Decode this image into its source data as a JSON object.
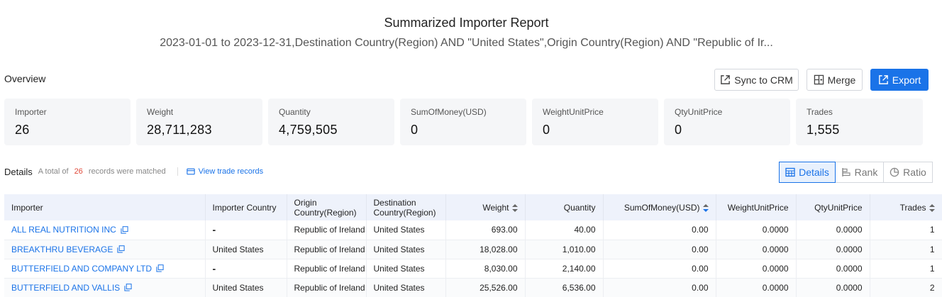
{
  "report": {
    "title": "Summarized Importer Report",
    "subtitle": "2023-01-01 to 2023-12-31,Destination Country(Region) AND \"United States\",Origin Country(Region) AND \"Republic of Ir..."
  },
  "overview": {
    "label": "Overview",
    "buttons": {
      "sync": "Sync to CRM",
      "merge": "Merge",
      "export": "Export"
    },
    "stats": [
      {
        "label": "Importer",
        "value": "26"
      },
      {
        "label": "Weight",
        "value": "28,711,283"
      },
      {
        "label": "Quantity",
        "value": "4,759,505"
      },
      {
        "label": "SumOfMoney(USD)",
        "value": "0"
      },
      {
        "label": "WeightUnitPrice",
        "value": "0"
      },
      {
        "label": "QtyUnitPrice",
        "value": "0"
      },
      {
        "label": "Trades",
        "value": "1,555"
      }
    ]
  },
  "details": {
    "label": "Details",
    "total_prefix": "A total of",
    "count": "26",
    "total_suffix": "records were matched",
    "view_link": "View trade records",
    "views": {
      "details": "Details",
      "rank": "Rank",
      "ratio": "Ratio"
    }
  },
  "table": {
    "headers": {
      "importer": "Importer",
      "importer_country": "Importer Country",
      "origin": "Origin Country(Region)",
      "destination": "Destination Country(Region)",
      "weight": "Weight",
      "quantity": "Quantity",
      "sum": "SumOfMoney(USD)",
      "wup": "WeightUnitPrice",
      "qup": "QtyUnitPrice",
      "trades": "Trades"
    },
    "rows": [
      {
        "importer": "ALL REAL NUTRITION INC",
        "importer_country": "-",
        "origin": "Republic of Ireland",
        "destination": "United States",
        "weight": "693.00",
        "quantity": "40.00",
        "sum": "0.00",
        "wup": "0.0000",
        "qup": "0.0000",
        "trades": "1"
      },
      {
        "importer": "BREAKTHRU BEVERAGE",
        "importer_country": "United States",
        "origin": "Republic of Ireland",
        "destination": "United States",
        "weight": "18,028.00",
        "quantity": "1,010.00",
        "sum": "0.00",
        "wup": "0.0000",
        "qup": "0.0000",
        "trades": "1"
      },
      {
        "importer": "BUTTERFIELD AND COMPANY LTD",
        "importer_country": "-",
        "origin": "Republic of Ireland",
        "destination": "United States",
        "weight": "8,030.00",
        "quantity": "2,140.00",
        "sum": "0.00",
        "wup": "0.0000",
        "qup": "0.0000",
        "trades": "1"
      },
      {
        "importer": "BUTTERFIELD AND VALLIS",
        "importer_country": "United States",
        "origin": "Republic of Ireland",
        "destination": "United States",
        "weight": "25,526.00",
        "quantity": "6,536.00",
        "sum": "0.00",
        "wup": "0.0000",
        "qup": "0.0000",
        "trades": "2"
      }
    ]
  },
  "icons": {
    "sync": "external-link-icon",
    "merge": "merge-icon",
    "export": "export-icon",
    "view": "card-icon",
    "copy": "copy-icon",
    "sort": "sort-icon",
    "details_view": "table-icon",
    "rank_view": "bar-icon",
    "ratio_view": "pie-icon"
  },
  "colors": {
    "accent": "#1a73e8",
    "count": "#e04a3a",
    "header_bg": "#eef2fb"
  }
}
